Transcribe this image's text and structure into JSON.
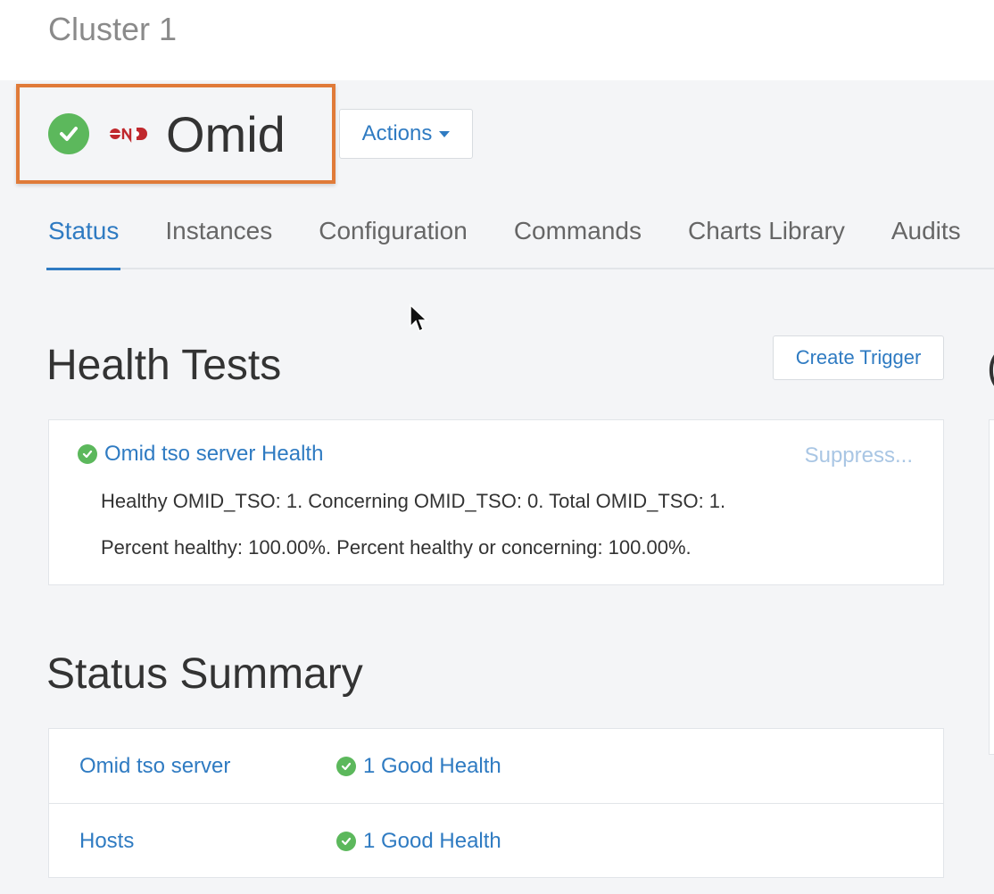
{
  "cluster": {
    "name": "Cluster 1"
  },
  "service": {
    "name": "Omid",
    "status_icon": "check-circle-icon",
    "logo_icon": "omid-logo-icon",
    "actions_label": "Actions"
  },
  "tabs": [
    {
      "label": "Status",
      "active": true
    },
    {
      "label": "Instances"
    },
    {
      "label": "Configuration"
    },
    {
      "label": "Commands"
    },
    {
      "label": "Charts Library"
    },
    {
      "label": "Audits"
    }
  ],
  "health_tests": {
    "title": "Health Tests",
    "create_trigger_label": "Create Trigger",
    "items": [
      {
        "name": "Omid tso server Health",
        "suppress_label": "Suppress...",
        "line1": "Healthy OMID_TSO: 1. Concerning OMID_TSO: 0. Total OMID_TSO: 1.",
        "line2": "Percent healthy: 100.00%. Percent healthy or concerning: 100.00%."
      }
    ]
  },
  "right_panel": {
    "partial_title": "("
  },
  "status_summary": {
    "title": "Status Summary",
    "rows": [
      {
        "name": "Omid tso server",
        "status": "1 Good Health"
      },
      {
        "name": "Hosts",
        "status": "1 Good Health"
      }
    ]
  },
  "colors": {
    "accent": "#2f7bc2",
    "good": "#5cb85c",
    "highlight_border": "#e07b39",
    "logo_red": "#c0282d"
  }
}
